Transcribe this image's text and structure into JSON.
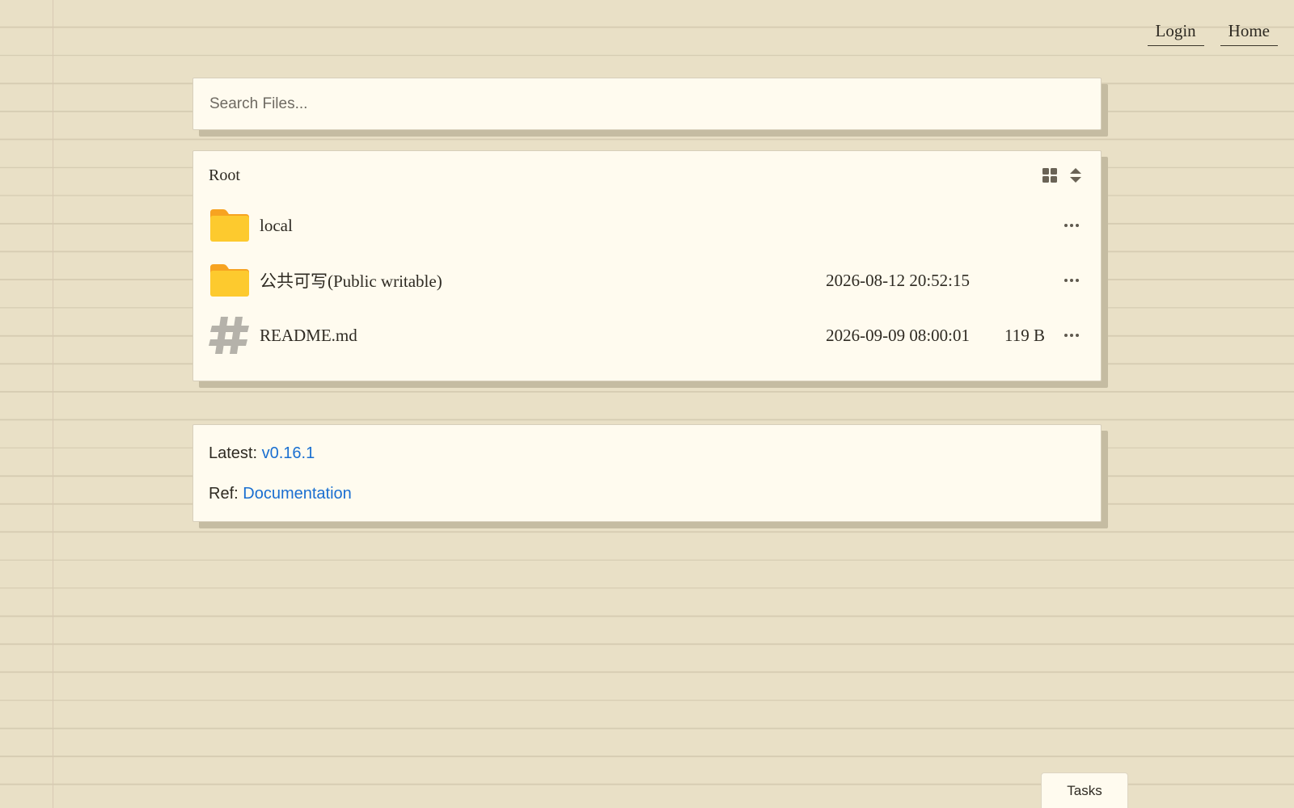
{
  "nav": {
    "links": [
      {
        "label": "Login"
      },
      {
        "label": "Home"
      }
    ]
  },
  "search": {
    "placeholder": "Search Files...",
    "value": ""
  },
  "files": {
    "breadcrumb": "Root",
    "header_icons": [
      "grid-view-icon",
      "sort-icon"
    ],
    "items": [
      {
        "name": "local",
        "type": "folder",
        "icon": "folder-icon",
        "date": "",
        "size": ""
      },
      {
        "name": "公共可写(Public writable)",
        "type": "folder",
        "icon": "folder-icon",
        "date": "2026-08-12 20:52:15",
        "size": ""
      },
      {
        "name": "README.md",
        "type": "markdown",
        "icon": "hash-icon",
        "date": "2026-09-09 08:00:01",
        "size": "119 B"
      }
    ]
  },
  "info": {
    "latest_label": "Latest:",
    "latest_link": "v0.16.1",
    "ref_label": "Ref:",
    "ref_link": "Documentation"
  },
  "tasks": {
    "label": "Tasks"
  },
  "colors": {
    "background": "#e9e0c6",
    "card": "#fffbef",
    "card_shadow": "#c5bca2",
    "link": "#1a6fd1",
    "folder": "#fdca2e",
    "folder_tab": "#f7a321",
    "hash_icon": "#b5b2aa"
  }
}
